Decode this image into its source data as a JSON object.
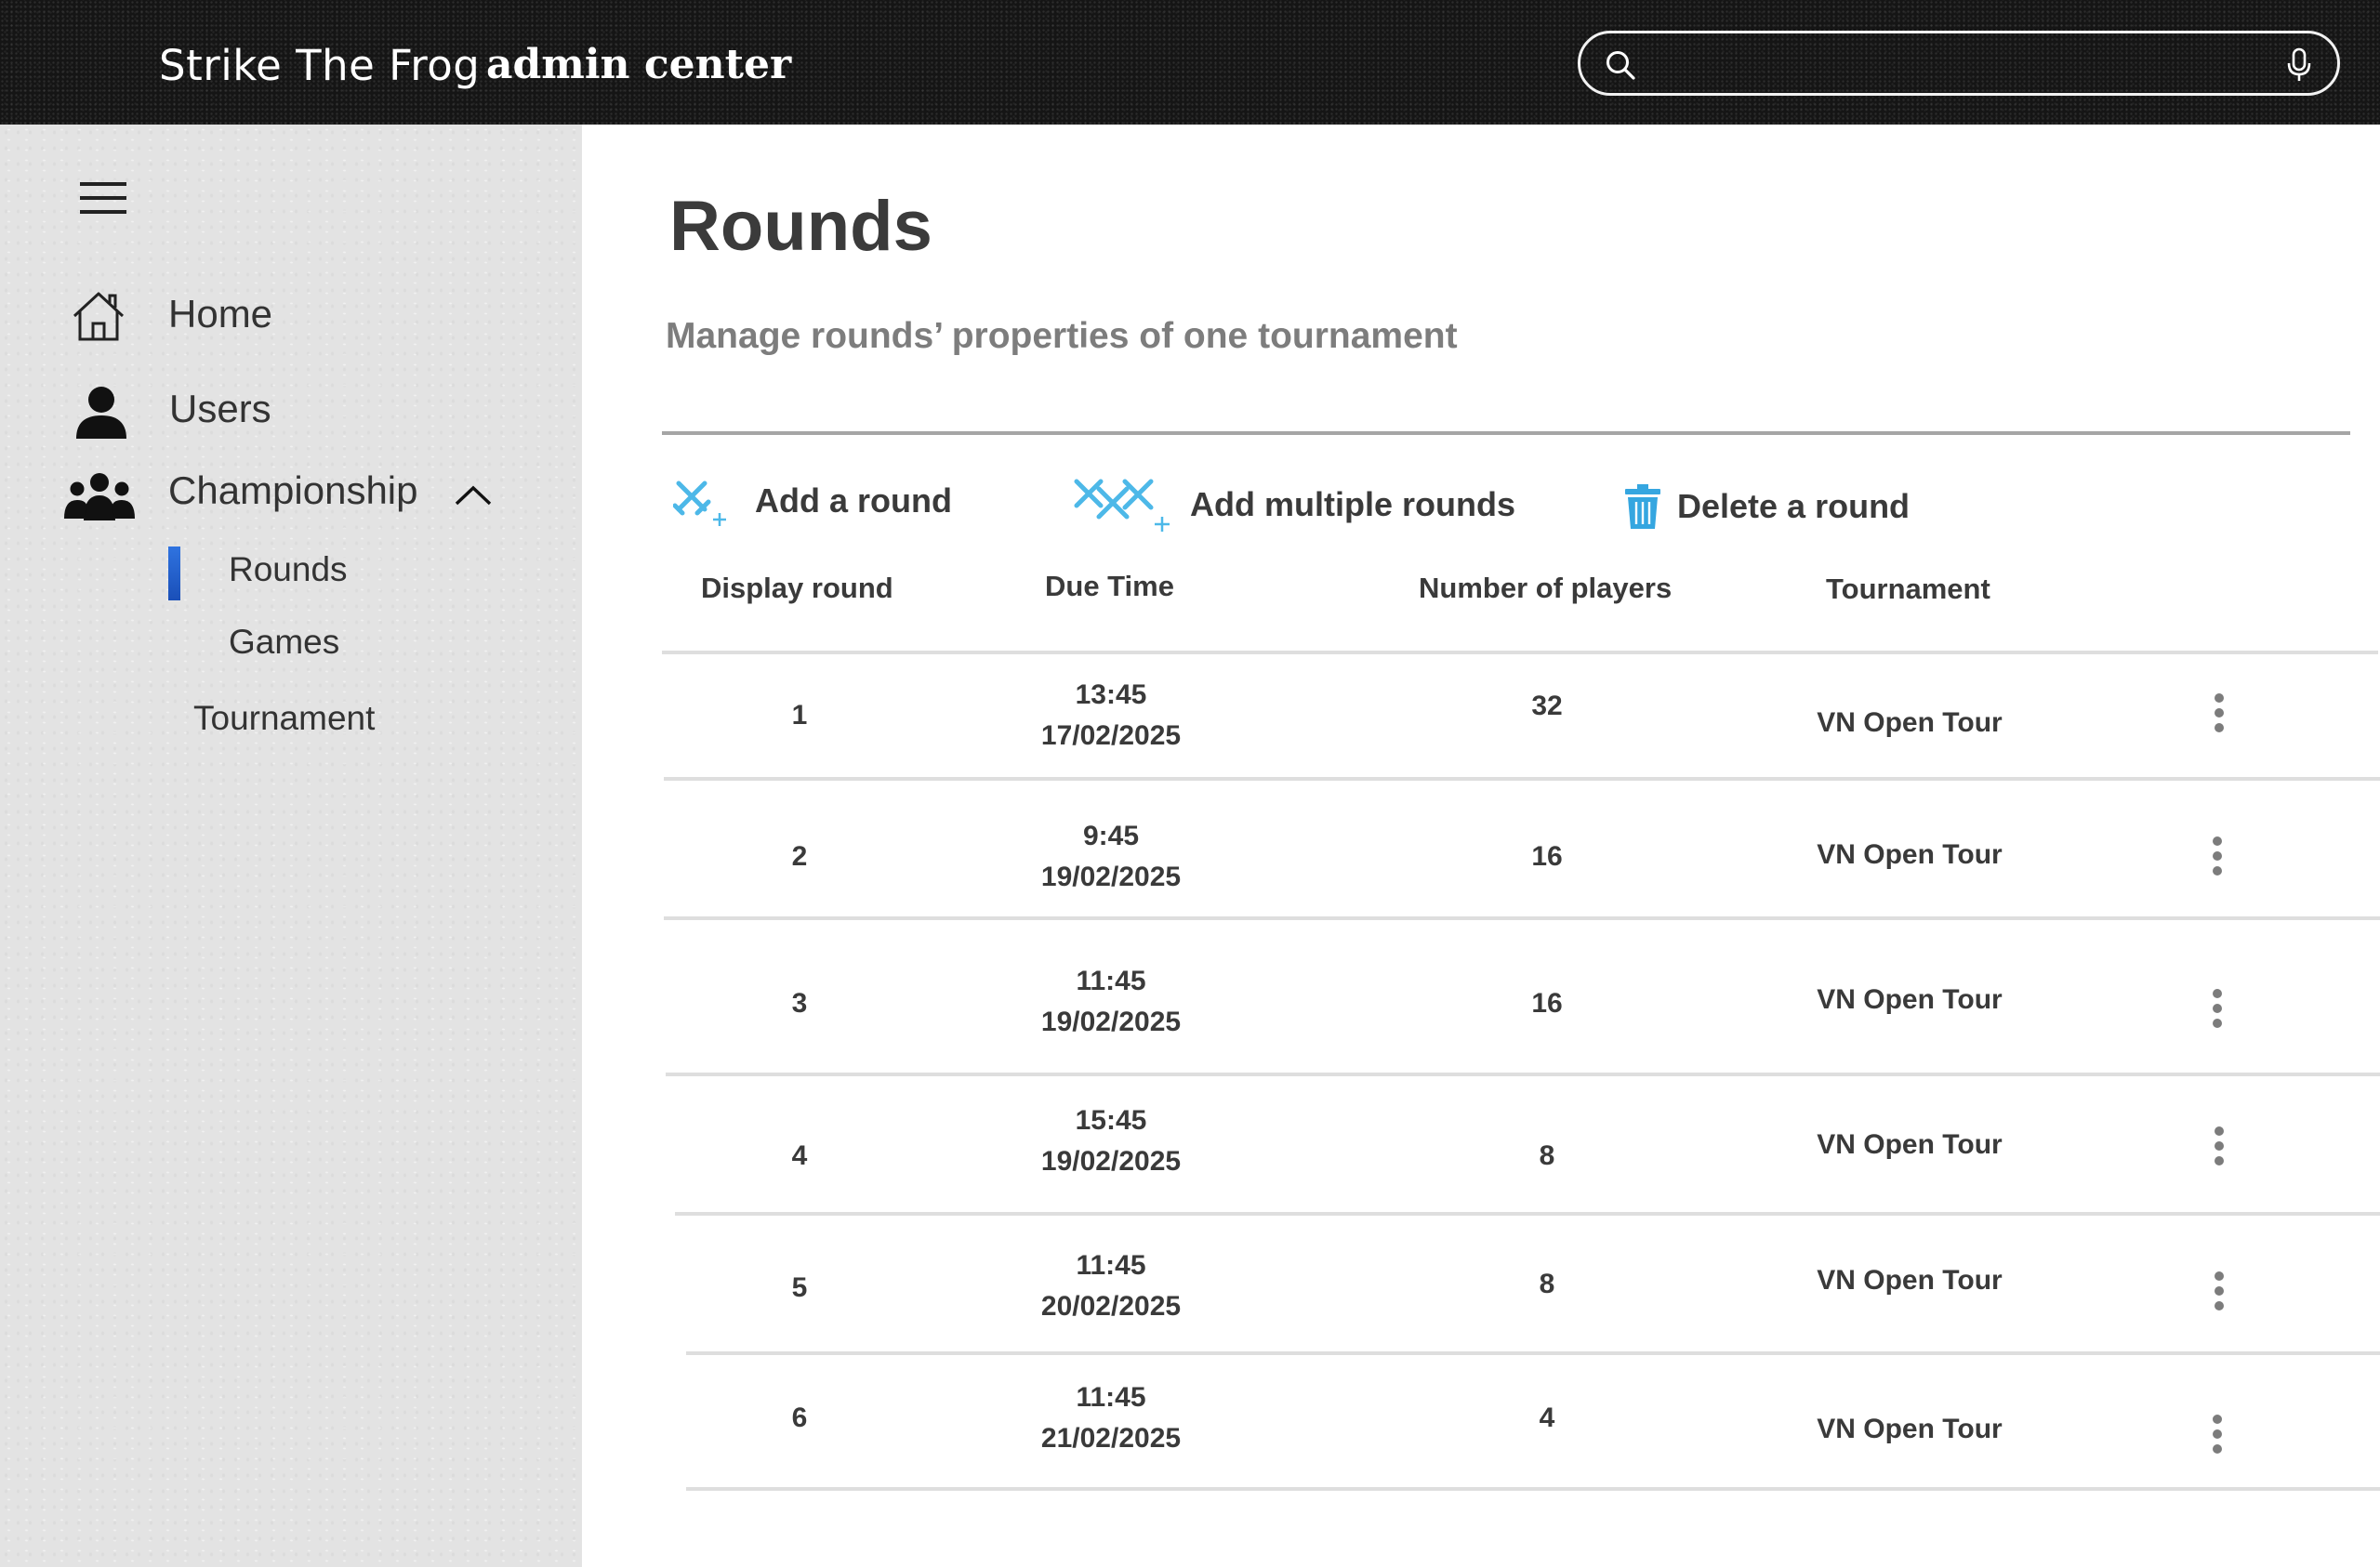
{
  "header": {
    "brand": "Strike The Frog",
    "brand_sub": "admin center",
    "search": {
      "value": "",
      "placeholder": ""
    }
  },
  "sidebar": {
    "items": [
      {
        "label": "Home",
        "icon": "home-icon"
      },
      {
        "label": "Users",
        "icon": "user-icon"
      },
      {
        "label": "Championship",
        "icon": "group-icon",
        "expanded": true
      }
    ],
    "sub_items": [
      {
        "label": "Rounds",
        "active": true
      },
      {
        "label": "Games",
        "active": false
      }
    ],
    "tournament_label": "Tournament"
  },
  "main": {
    "title": "Rounds",
    "subtitle": "Manage rounds’ properties of one tournament",
    "actions": {
      "add_round": "Add a round",
      "add_multiple": "Add multiple rounds",
      "delete_round": "Delete a round"
    },
    "columns": {
      "display_round": "Display round",
      "due_time": "Due Time",
      "players": "Number of players",
      "tournament": "Tournament"
    },
    "rows": [
      {
        "round": "1",
        "time": "13:45",
        "date": "17/02/2025",
        "players": "32",
        "tournament": "VN Open Tour"
      },
      {
        "round": "2",
        "time": "9:45",
        "date": "19/02/2025",
        "players": "16",
        "tournament": "VN Open Tour"
      },
      {
        "round": "3",
        "time": "11:45",
        "date": "19/02/2025",
        "players": "16",
        "tournament": "VN Open Tour"
      },
      {
        "round": "4",
        "time": "15:45",
        "date": "19/02/2025",
        "players": "8",
        "tournament": "VN Open Tour"
      },
      {
        "round": "5",
        "time": "11:45",
        "date": "20/02/2025",
        "players": "8",
        "tournament": "VN Open Tour"
      },
      {
        "round": "6",
        "time": "11:45",
        "date": "21/02/2025",
        "players": "4",
        "tournament": "VN Open Tour"
      }
    ]
  },
  "colors": {
    "header_bg": "#151515",
    "sidebar_bg": "#e3e3e3",
    "accent_blue": "#1f5fd0",
    "icon_cyan": "#4db8e8"
  }
}
